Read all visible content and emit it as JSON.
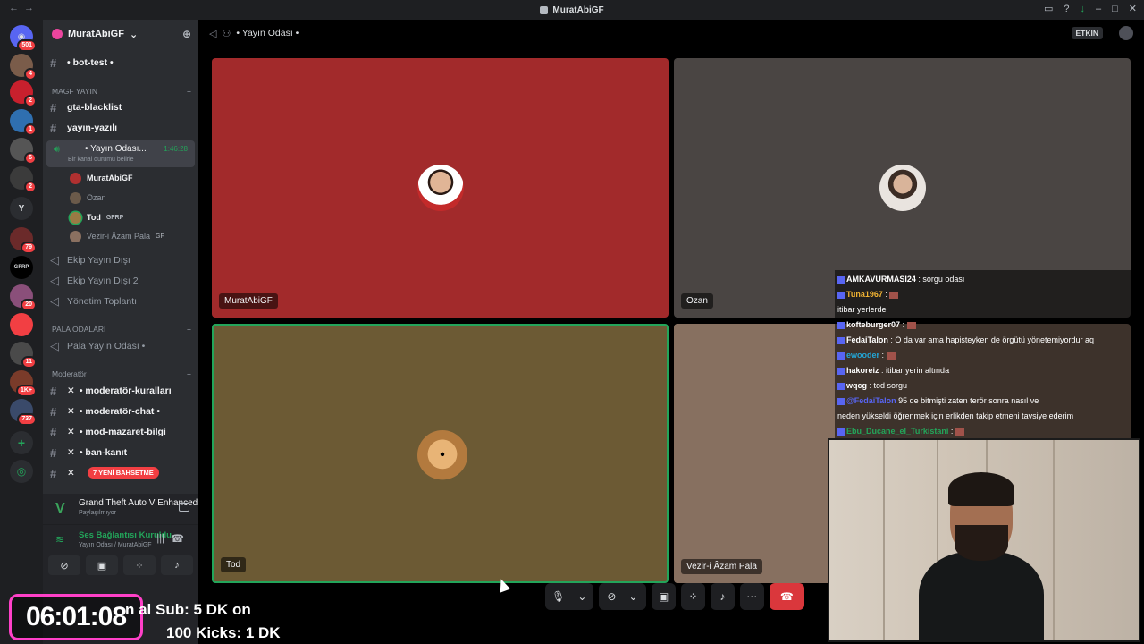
{
  "window": {
    "title": "MuratAbiGF"
  },
  "rail": {
    "badges": [
      "501",
      "4",
      "2",
      "1",
      "6",
      "2",
      "79",
      "20",
      "11",
      "1K+",
      "737"
    ],
    "letters": [
      "Y",
      "GFRP"
    ]
  },
  "server": {
    "name": "MuratAbiGF"
  },
  "channels": {
    "bot_test": "• bot-test •",
    "cat_magf": "MAGF YAYIN",
    "gta_blacklist": "gta-blacklist",
    "yayin_yazili": "yayın-yazılı",
    "live": {
      "name": "• Yayın Odası...",
      "timer": "1:46:28",
      "status": "Bir kanal durumu belirle"
    },
    "members": [
      {
        "name": "MuratAbiGF",
        "tag": ""
      },
      {
        "name": "Ozan",
        "tag": ""
      },
      {
        "name": "Tod",
        "tag": "GFRP"
      },
      {
        "name": "Vezir-i Âzam Pala",
        "tag": "GF"
      }
    ],
    "ekip1": "Ekip Yayın Dışı",
    "ekip2": "Ekip Yayın Dışı 2",
    "yonetim": "Yönetim Toplantı",
    "cat_pala": "PALA ODALARI",
    "pala_yayin": "Pala Yayın Odası •",
    "cat_mod": "Moderatör",
    "mod_kurallari": "• moderatör-kuralları",
    "mod_chat": "• moderatör-chat •",
    "mod_mazaret": "• mod-mazaret-bilgi",
    "ban_kanit": "• ban-kanıt",
    "new_badge": "7 YENİ BAHSETME"
  },
  "activity": {
    "game": "Grand Theft Auto V Enhanced",
    "status": "Paylaşılmıyor"
  },
  "voice": {
    "status": "Ses Bağlantısı Kuruldu",
    "channel": "Yayın Odası / MuratAbiGF"
  },
  "topbar": {
    "channel": "• Yayın Odası •",
    "etkin": "ETKİN"
  },
  "tiles": [
    {
      "name": "MuratAbiGF"
    },
    {
      "name": "Ozan"
    },
    {
      "name": "Tod"
    },
    {
      "name": "Vezir-i Âzam Pala"
    }
  ],
  "chat": [
    {
      "user": "AMKAVURMASI24",
      "msg": "sorgu odası",
      "color": "#ffffff"
    },
    {
      "user": "Tuna1967",
      "msg": "",
      "color": "#f0b232"
    },
    {
      "user": "",
      "msg": "itibar yerlerde",
      "color": "#f23f43"
    },
    {
      "user": "kofteburger07",
      "msg": "",
      "color": "#ffffff"
    },
    {
      "user": "FedaiTalon",
      "msg": "O da var ama hapisteyken de örgütü yönetemiyordur aq",
      "color": "#ffffff"
    },
    {
      "user": "ewooder",
      "msg": "",
      "color": "#23a5d5"
    },
    {
      "user": "hakoreiz",
      "msg": "itibar yerin altında",
      "color": "#ffffff"
    },
    {
      "user": "wqcg",
      "msg": "tod sorgu",
      "color": "#ffffff"
    },
    {
      "user": "@FedaiTalon",
      "msg": "95 de bitmişti zaten terör sonra nasıl ve",
      "color": "#5865f2"
    },
    {
      "user": "",
      "msg": "neden yükseldi öğrenmek için erlikden takip etmeni tavsiye ederim",
      "color": "#ffffff"
    },
    {
      "user": "Ebu_Ducane_el_Turkistani",
      "msg": "",
      "color": "#23a55a"
    }
  ],
  "overlay": {
    "clock": "06:01:08",
    "line1": "n al Sub: 5 DK on",
    "line2": "100 Kicks: 1 DK"
  },
  "colors": {
    "accent": "#5865f2",
    "live": "#23a55a",
    "danger": "#da373c"
  }
}
